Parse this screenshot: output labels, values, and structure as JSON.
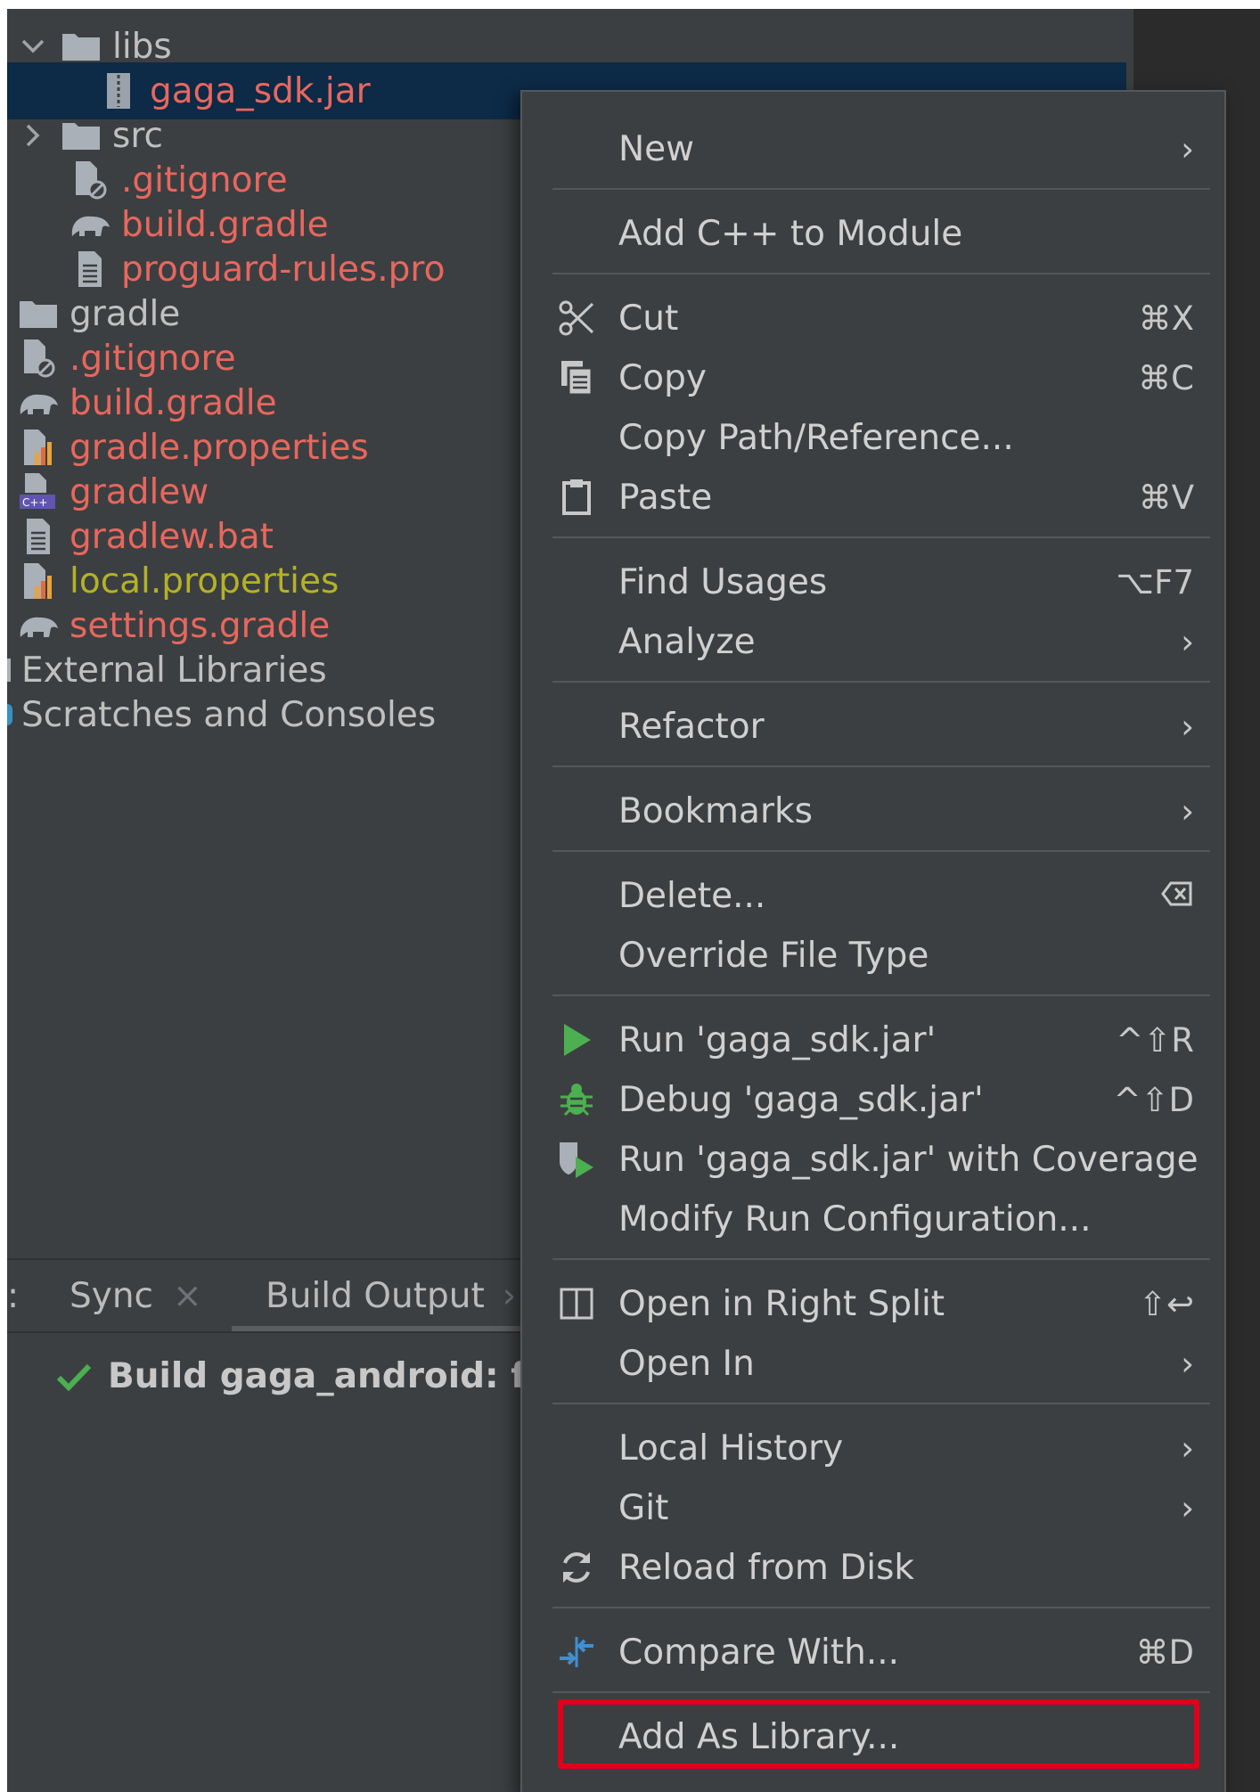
{
  "tree": {
    "items": [
      {
        "label": "libs",
        "icon": "folder-icon",
        "expand": "chevron-down-icon",
        "color": "grey"
      },
      {
        "label": "gaga_sdk.jar",
        "icon": "jar-icon",
        "color": "red",
        "selected": true
      },
      {
        "label": "src",
        "icon": "folder-icon",
        "expand": "chevron-right-icon",
        "color": "grey"
      },
      {
        "label": ".gitignore",
        "icon": "gitignore-file-icon",
        "color": "red"
      },
      {
        "label": "build.gradle",
        "icon": "gradle-elephant-icon",
        "color": "red"
      },
      {
        "label": "proguard-rules.pro",
        "icon": "text-file-icon",
        "color": "red"
      },
      {
        "label": "gradle",
        "icon": "folder-icon",
        "color": "grey"
      },
      {
        "label": ".gitignore",
        "icon": "gitignore-file-icon",
        "color": "red"
      },
      {
        "label": "build.gradle",
        "icon": "gradle-elephant-icon",
        "color": "red"
      },
      {
        "label": "gradle.properties",
        "icon": "properties-file-icon",
        "color": "red"
      },
      {
        "label": "gradlew",
        "icon": "cpp-script-file-icon",
        "color": "red"
      },
      {
        "label": "gradlew.bat",
        "icon": "text-file-icon",
        "color": "red"
      },
      {
        "label": "local.properties",
        "icon": "properties-file-icon",
        "color": "yellow"
      },
      {
        "label": "settings.gradle",
        "icon": "gradle-elephant-icon",
        "color": "red"
      },
      {
        "label": "External Libraries",
        "icon": "library-icon",
        "color": "grey"
      },
      {
        "label": "Scratches and Consoles",
        "icon": "scratches-icon",
        "color": "grey"
      }
    ]
  },
  "bottom_panel": {
    "tab_prefix": ":",
    "tab_sync": "Sync",
    "tab_sync_close": "×",
    "tab_build_output": "Build Output",
    "tab_build_output_chevron": "›",
    "build_status": "Build gaga_android: fi"
  },
  "context_menu": {
    "items": {
      "new": {
        "label": "New",
        "submenu": "›"
      },
      "add_cpp": {
        "label": "Add C++ to Module"
      },
      "cut": {
        "label": "Cut",
        "shortcut": "⌘X",
        "icon": "scissors-icon"
      },
      "copy": {
        "label": "Copy",
        "shortcut": "⌘C",
        "icon": "copy-icon"
      },
      "copy_path": {
        "label": "Copy Path/Reference..."
      },
      "paste": {
        "label": "Paste",
        "shortcut": "⌘V",
        "icon": "clipboard-icon"
      },
      "find_usages": {
        "label": "Find Usages",
        "shortcut": "⌥F7"
      },
      "analyze": {
        "label": "Analyze",
        "submenu": "›"
      },
      "refactor": {
        "label": "Refactor",
        "submenu": "›"
      },
      "bookmarks": {
        "label": "Bookmarks",
        "submenu": "›"
      },
      "delete": {
        "label": "Delete...",
        "shortcut_icon": "delete-key-icon"
      },
      "override_type": {
        "label": "Override File Type"
      },
      "run": {
        "label": "Run 'gaga_sdk.jar'",
        "shortcut": "^⇧R",
        "icon": "run-triangle-icon"
      },
      "debug": {
        "label": "Debug 'gaga_sdk.jar'",
        "shortcut": "^⇧D",
        "icon": "bug-icon"
      },
      "run_coverage": {
        "label": "Run 'gaga_sdk.jar' with Coverage",
        "icon": "coverage-icon"
      },
      "modify_run": {
        "label": "Modify Run Configuration..."
      },
      "open_right_split": {
        "label": "Open in Right Split",
        "shortcut": "⇧↩",
        "icon": "split-pane-icon"
      },
      "open_in": {
        "label": "Open In",
        "submenu": "›"
      },
      "local_history": {
        "label": "Local History",
        "submenu": "›"
      },
      "git": {
        "label": "Git",
        "submenu": "›"
      },
      "reload": {
        "label": "Reload from Disk",
        "icon": "reload-icon"
      },
      "compare": {
        "label": "Compare With...",
        "shortcut": "⌘D",
        "icon": "compare-arrows-icon"
      },
      "add_library": {
        "label": "Add As Library...",
        "highlighted": true
      }
    }
  },
  "colors": {
    "background": "#3c3f41",
    "selection": "#0d2a47",
    "file_red": "#e8675e",
    "file_yellow": "#b4b227",
    "highlight_border": "#e0001b",
    "run_green": "#4caf50"
  }
}
